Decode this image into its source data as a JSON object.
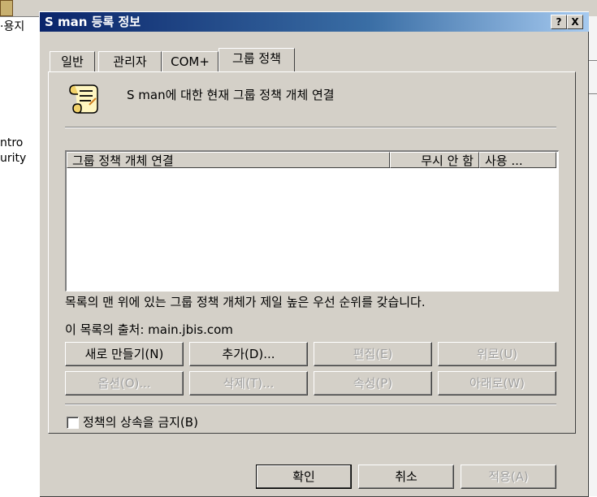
{
  "background": {
    "frag_top": "·용지",
    "frag_mid1": "ntro",
    "frag_mid2": "urity"
  },
  "window": {
    "title": "S man 등록 정보",
    "help_btn": "?",
    "close_btn": "X"
  },
  "tabs": [
    {
      "label": "일반"
    },
    {
      "label": "관리자"
    },
    {
      "label": "COM+"
    },
    {
      "label": "그룹 정책",
      "active": true
    }
  ],
  "panel": {
    "header": "S man에 대한 현재 그룹 정책 개체 연결",
    "icon": "scroll-icon",
    "columns": [
      "그룹 정책 개체 연결",
      "무시 안 함",
      "사용 ..."
    ],
    "rows": [],
    "priority_note": "목록의 맨 위에 있는 그룹 정책 개체가 제일 높은 우선 순위를 갖습니다.",
    "source_label": "이 목록의 출처: main.jbis.com",
    "buttons_row1": [
      {
        "label": "새로 만들기(N)",
        "enabled": true
      },
      {
        "label": "추가(D)...",
        "enabled": true
      },
      {
        "label": "편집(E)",
        "enabled": false
      },
      {
        "label": "위로(U)",
        "enabled": false
      }
    ],
    "buttons_row2": [
      {
        "label": "옵션(O)...",
        "enabled": false
      },
      {
        "label": "삭제(T)...",
        "enabled": false
      },
      {
        "label": "속성(P)",
        "enabled": false
      },
      {
        "label": "아래로(W)",
        "enabled": false
      }
    ],
    "block_inheritance": {
      "label": "정책의 상속을 금지(B)",
      "checked": false
    }
  },
  "footer": {
    "ok": "확인",
    "cancel": "취소",
    "apply": "적용(A)"
  }
}
